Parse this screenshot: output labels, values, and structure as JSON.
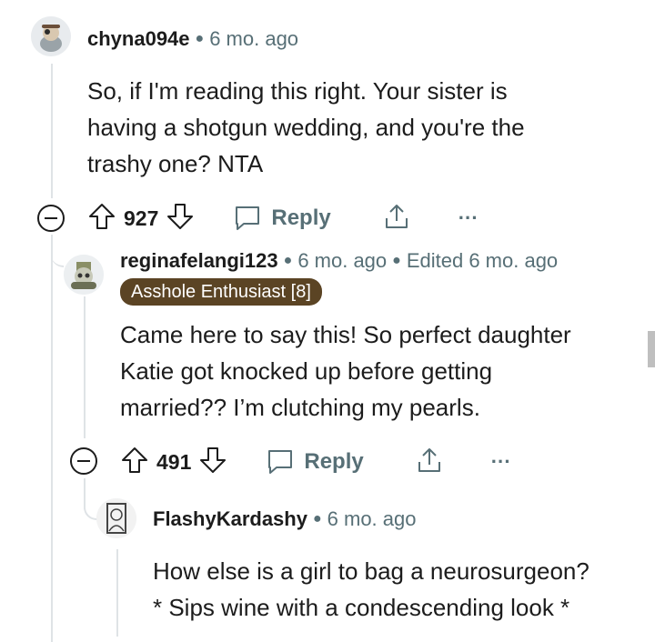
{
  "comments": [
    {
      "username": "chyna094e",
      "time": "6 mo. ago",
      "body_lines": [
        "So, if I'm reading this right. Your sister is",
        "having a shotgun wedding, and you're the",
        "trashy one? NTA"
      ],
      "votes": "927",
      "reply_label": "Reply",
      "more_label": "···"
    },
    {
      "username": "reginafelangi123",
      "time": "6 mo. ago",
      "edited": "Edited 6 mo. ago",
      "flair": "Asshole Enthusiast [8]",
      "body_lines": [
        "Came here to say this! So perfect daughter",
        "Katie got knocked up before getting",
        "married?? I’m clutching my pearls."
      ],
      "votes": "491",
      "reply_label": "Reply",
      "more_label": "···"
    },
    {
      "username": "FlashyKardashy",
      "time": "6 mo. ago",
      "body_lines": [
        "How else is a girl to bag a neurosurgeon?",
        "* Sips wine with a condescending look *"
      ]
    }
  ],
  "colors": {
    "meta": "#576f76",
    "flair_bg": "#5b4424",
    "thread": "#dfe3e6"
  }
}
